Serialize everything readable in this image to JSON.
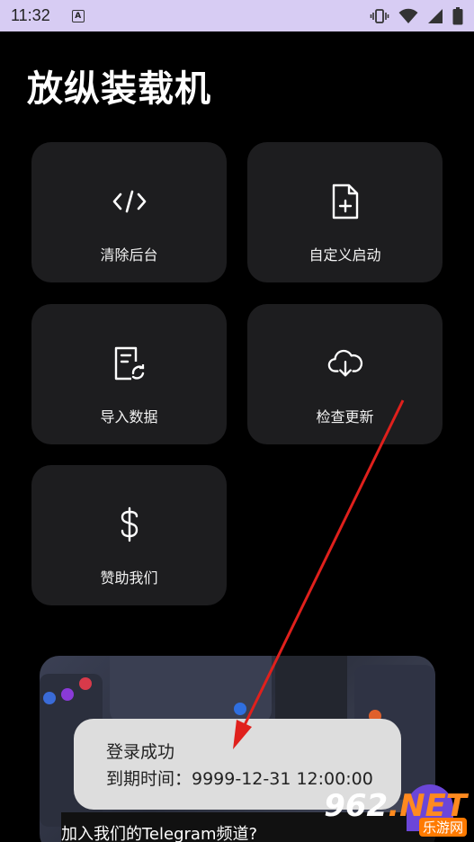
{
  "status_bar": {
    "time": "11:32",
    "indicator": "A"
  },
  "app": {
    "title": "放纵装载机"
  },
  "tiles": [
    {
      "label": "清除后台",
      "icon": "code-icon"
    },
    {
      "label": "自定义启动",
      "icon": "file-plus-icon"
    },
    {
      "label": "导入数据",
      "icon": "file-sync-icon"
    },
    {
      "label": "检查更新",
      "icon": "cloud-download-icon"
    },
    {
      "label": "赞助我们",
      "icon": "dollar-icon"
    }
  ],
  "banner": {
    "caption": "加入我们的Telegram频道?"
  },
  "toast": {
    "title": "登录成功",
    "expiry": "到期时间：9999-12-31 12:00:00"
  },
  "watermark": {
    "brand_num": "962",
    "brand_net": ".NET",
    "sub": "乐游网"
  },
  "colors": {
    "status_bar": "#d7ccf3",
    "tile": "#1d1d1f",
    "toast": "#dddddd",
    "arrow": "#e0201c",
    "fab": "#6b46d8"
  }
}
